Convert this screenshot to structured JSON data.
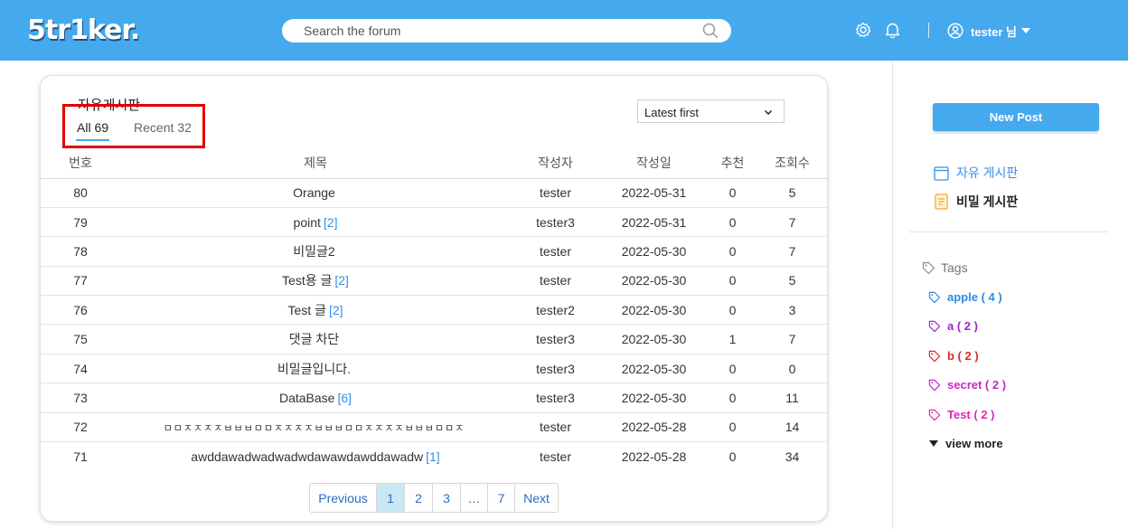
{
  "header": {
    "logo": "5tr1ker.",
    "search_placeholder": "Search the forum",
    "user_name": "tester 님"
  },
  "board": {
    "title": "자유게시판",
    "tabs": [
      {
        "label": "All",
        "count": "69",
        "active": true
      },
      {
        "label": "Recent",
        "count": "32",
        "active": false
      }
    ],
    "sort_selected": "Latest first",
    "columns": [
      "번호",
      "제목",
      "작성자",
      "작성일",
      "추천",
      "조회수"
    ],
    "rows": [
      {
        "no": "80",
        "title": "Orange",
        "comments": "",
        "author": "tester",
        "date": "2022-05-31",
        "likes": "0",
        "views": "5"
      },
      {
        "no": "79",
        "title": "point",
        "comments": "[2]",
        "author": "tester3",
        "date": "2022-05-31",
        "likes": "0",
        "views": "7"
      },
      {
        "no": "78",
        "title": "비밀글2",
        "comments": "",
        "author": "tester",
        "date": "2022-05-30",
        "likes": "0",
        "views": "7"
      },
      {
        "no": "77",
        "title": "Test용 글",
        "comments": "[2]",
        "author": "tester",
        "date": "2022-05-30",
        "likes": "0",
        "views": "5"
      },
      {
        "no": "76",
        "title": "Test 글",
        "comments": "[2]",
        "author": "tester2",
        "date": "2022-05-30",
        "likes": "0",
        "views": "3"
      },
      {
        "no": "75",
        "title": "댓글 차단",
        "comments": "",
        "author": "tester3",
        "date": "2022-05-30",
        "likes": "1",
        "views": "7"
      },
      {
        "no": "74",
        "title": "비밀글입니다.",
        "comments": "",
        "author": "tester3",
        "date": "2022-05-30",
        "likes": "0",
        "views": "0"
      },
      {
        "no": "73",
        "title": "DataBase",
        "comments": "[6]",
        "author": "tester3",
        "date": "2022-05-30",
        "likes": "0",
        "views": "11"
      },
      {
        "no": "72",
        "title": "ㅁㅁㅈㅈㅈㅈㅂㅂㅂㅁㅁㅈㅈㅈㅈㅂㅂㅂㅁㅁㅈㅈㅈㅈㅂㅂㅂㅁㅁㅈ",
        "comments": "",
        "author": "tester",
        "date": "2022-05-28",
        "likes": "0",
        "views": "14"
      },
      {
        "no": "71",
        "title": "awddawadwadwadwdawawdawddawadw",
        "comments": "[1]",
        "author": "tester",
        "date": "2022-05-28",
        "likes": "0",
        "views": "34"
      }
    ],
    "pagination": [
      "Previous",
      "1",
      "2",
      "3",
      "…",
      "7",
      "Next"
    ],
    "current_page": "1"
  },
  "sidebar": {
    "new_post_label": "New Post",
    "boards": [
      {
        "label": "자유 게시판",
        "icon": "calendar-icon",
        "color": "#3a8ee6"
      },
      {
        "label": "비밀 게시판",
        "icon": "notebook-icon",
        "color": "#222222"
      }
    ],
    "tags_title": "Tags",
    "tags": [
      {
        "label": "apple ( 4 )",
        "color": "#2b8de0"
      },
      {
        "label": "a ( 2 )",
        "color": "#9b27c9"
      },
      {
        "label": "b ( 2 )",
        "color": "#e02828"
      },
      {
        "label": "secret ( 2 )",
        "color": "#c727c9"
      },
      {
        "label": "Test ( 2 )",
        "color": "#e227b8"
      }
    ],
    "view_more_label": "view more"
  },
  "colors": {
    "header_bg": "#45a9ee",
    "accent_link": "#3a8ee6",
    "active_page_bg": "#c9e8f3",
    "highlight_box": "#e00000"
  }
}
